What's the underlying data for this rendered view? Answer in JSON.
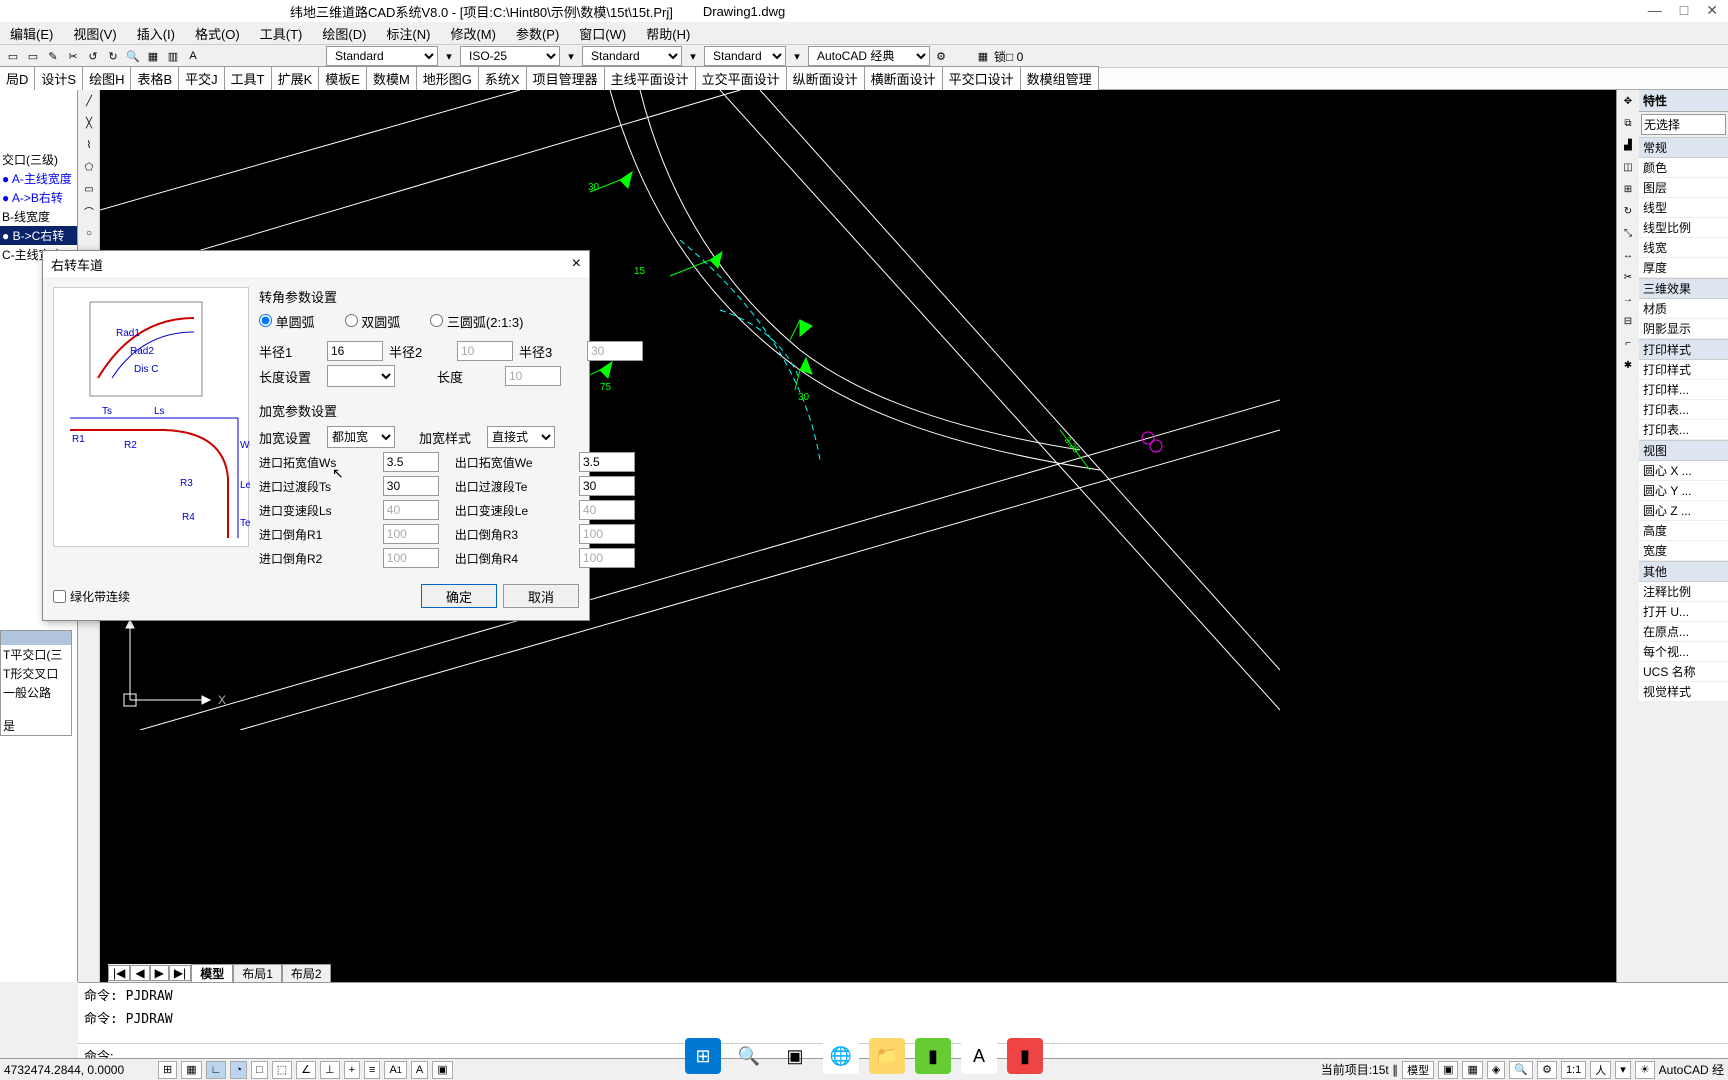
{
  "titlebar": {
    "app_title": "纬地三维道路CAD系统V8.0 - [项目:C:\\Hint80\\示例\\数模\\15t\\15t.Prj]",
    "filename": "Drawing1.dwg"
  },
  "menu": [
    "编辑(E)",
    "视图(V)",
    "插入(I)",
    "格式(O)",
    "工具(T)",
    "绘图(D)",
    "标注(N)",
    "修改(M)",
    "参数(P)",
    "窗口(W)",
    "帮助(H)"
  ],
  "toolbar_selects": {
    "s1": "Standard",
    "s2": "ISO-25",
    "s3": "Standard",
    "s4": "Standard",
    "s5": "AutoCAD 经典"
  },
  "lock_label": "锁□ 0",
  "ribbon": [
    "局D",
    "设计S",
    "绘图H",
    "表格B",
    "平交J",
    "工具T",
    "扩展K",
    "模板E",
    "数模M",
    "地形图G",
    "系统X",
    "项目管理器",
    "主线平面设计",
    "立交平面设计",
    "纵断面设计",
    "横断面设计",
    "平交口设计",
    "数模组管理"
  ],
  "tree": {
    "items": [
      {
        "label": "交口(三级)",
        "style": ""
      },
      {
        "label": "A-主线宽度",
        "style": "blue"
      },
      {
        "label": "A->B右转",
        "style": "blue"
      },
      {
        "label": "B-线宽度",
        "style": ""
      },
      {
        "label": "B->C右转",
        "style": "sel"
      },
      {
        "label": "C-主线宽度",
        "style": ""
      }
    ]
  },
  "dialog": {
    "title": "右转车道",
    "section1": "转角参数设置",
    "radios": {
      "r1": "单圆弧",
      "r2": "双圆弧",
      "r3": "三圆弧(2:1:3)"
    },
    "radius": {
      "r1_label": "半径1",
      "r1": "16",
      "r2_label": "半径2",
      "r2": "10",
      "r3_label": "半径3",
      "r3": "30"
    },
    "len_label": "长度设置",
    "len2_label": "长度",
    "len2": "10",
    "section2": "加宽参数设置",
    "widen_set_label": "加宽设置",
    "widen_set": "都加宽",
    "widen_style_label": "加宽样式",
    "widen_style": "直接式",
    "fields": {
      "in_w_label": "进口拓宽值Ws",
      "in_w": "3.5",
      "out_w_label": "出口拓宽值We",
      "out_w": "3.5",
      "in_t_label": "进口过渡段Ts",
      "in_t": "30",
      "out_t_label": "出口过渡段Te",
      "out_t": "30",
      "in_l_label": "进口变速段Ls",
      "in_l": "40",
      "out_l_label": "出口变速段Le",
      "out_l": "40",
      "in_r1_label": "进口倒角R1",
      "in_r1": "100",
      "out_r3_label": "出口倒角R3",
      "out_r3": "100",
      "in_r2_label": "进口倒角R2",
      "in_r2": "100",
      "out_r4_label": "出口倒角R4",
      "out_r4": "100"
    },
    "chk_label": "绿化带连续",
    "ok": "确定",
    "cancel": "取消"
  },
  "bottom_list": {
    "items": [
      "T平交口(三",
      "T形交叉口",
      "一般公路"
    ],
    "answer": "是"
  },
  "layout_tabs": {
    "model": "模型",
    "l1": "布局1",
    "l2": "布局2"
  },
  "cmd": {
    "h1": "命令:  PJDRAW",
    "h2": "命令:  PJDRAW",
    "prompt": "命令:"
  },
  "status": {
    "coords": "4732474.2844, 0.0000",
    "right": "当前项目:15t ∥",
    "model": "模型",
    "ratio": "1:1",
    "autocad": "AutoCAD 经"
  },
  "props": {
    "title": "特性",
    "sel": "无选择",
    "groups": [
      {
        "name": "常规",
        "rows": [
          "颜色",
          "图层",
          "线型",
          "线型比例",
          "线宽",
          "厚度"
        ]
      },
      {
        "name": "三维效果",
        "rows": [
          "材质",
          "阴影显示"
        ]
      },
      {
        "name": "打印样式",
        "rows": [
          "打印样式",
          "打印样...",
          "打印表...",
          "打印表..."
        ]
      },
      {
        "name": "视图",
        "rows": [
          "圆心 X ...",
          "圆心 Y ...",
          "圆心 Z ...",
          "高度",
          "宽度"
        ]
      },
      {
        "name": "其他",
        "rows": [
          "注释比例",
          "打开 U...",
          "在原点...",
          "每个视...",
          "UCS 名称",
          "视觉样式"
        ]
      }
    ]
  },
  "canvas_labels": {
    "a": "30",
    "b": "15",
    "c": "75",
    "d": "30"
  }
}
